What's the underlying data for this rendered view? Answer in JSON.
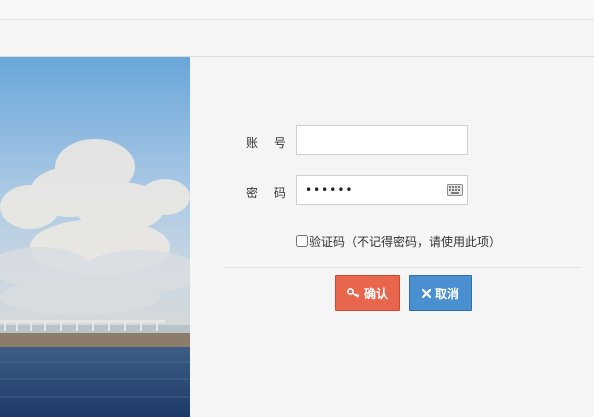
{
  "login": {
    "account_label": "账 号",
    "account_value": "",
    "password_label": "密 码",
    "password_value": "••••••",
    "captcha_label": "验证码（不记得密码，请使用此项）",
    "confirm_label": "确认",
    "cancel_label": "取消"
  },
  "icons": {
    "keyboard": "keyboard-icon",
    "key": "key-icon",
    "close": "close-icon"
  },
  "colors": {
    "confirm_bg": "#e8664c",
    "cancel_bg": "#4a8fd0"
  }
}
